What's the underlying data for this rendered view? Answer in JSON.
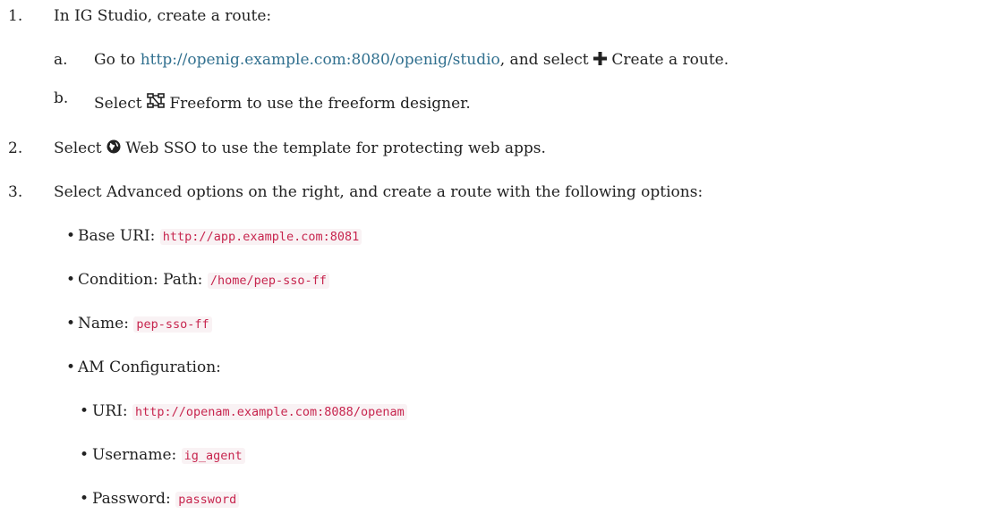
{
  "steps": {
    "s1": {
      "num": "1.",
      "text": "In IG Studio, create a route:"
    },
    "s1a": {
      "letter": "a.",
      "pre": "Go to ",
      "link": "http://openig.example.com:8080/openig/studio",
      "mid": ", and select ",
      "icon": "plus-icon",
      "post": " Create a route."
    },
    "s1b": {
      "letter": "b.",
      "pre": "Select ",
      "icon": "freeform-icon",
      "post": " Freeform to use the freeform designer."
    },
    "s2": {
      "num": "2.",
      "pre": "Select ",
      "icon": "globe-icon",
      "post": " Web SSO to use the template for protecting web apps."
    },
    "s3": {
      "num": "3.",
      "text": "Select Advanced options on the right, and create a route with the following options:"
    }
  },
  "options": {
    "base_uri": {
      "label": "Base URI: ",
      "value": "http://app.example.com:8081"
    },
    "condition": {
      "label": "Condition: Path: ",
      "value": "/home/pep-sso-ff"
    },
    "name": {
      "label": "Name: ",
      "value": "pep-sso-ff"
    },
    "am_config": {
      "label": "AM Configuration:"
    },
    "uri": {
      "label": "URI: ",
      "value": "http://openam.example.com:8088/openam"
    },
    "username": {
      "label": "Username: ",
      "value": "ig_agent"
    },
    "password": {
      "label": "Password: ",
      "value": "password"
    }
  },
  "bullet": "•",
  "colors": {
    "link": "#31708f",
    "code_text": "#c7254e",
    "code_bg": "#f9f2f4",
    "text": "#222222"
  }
}
